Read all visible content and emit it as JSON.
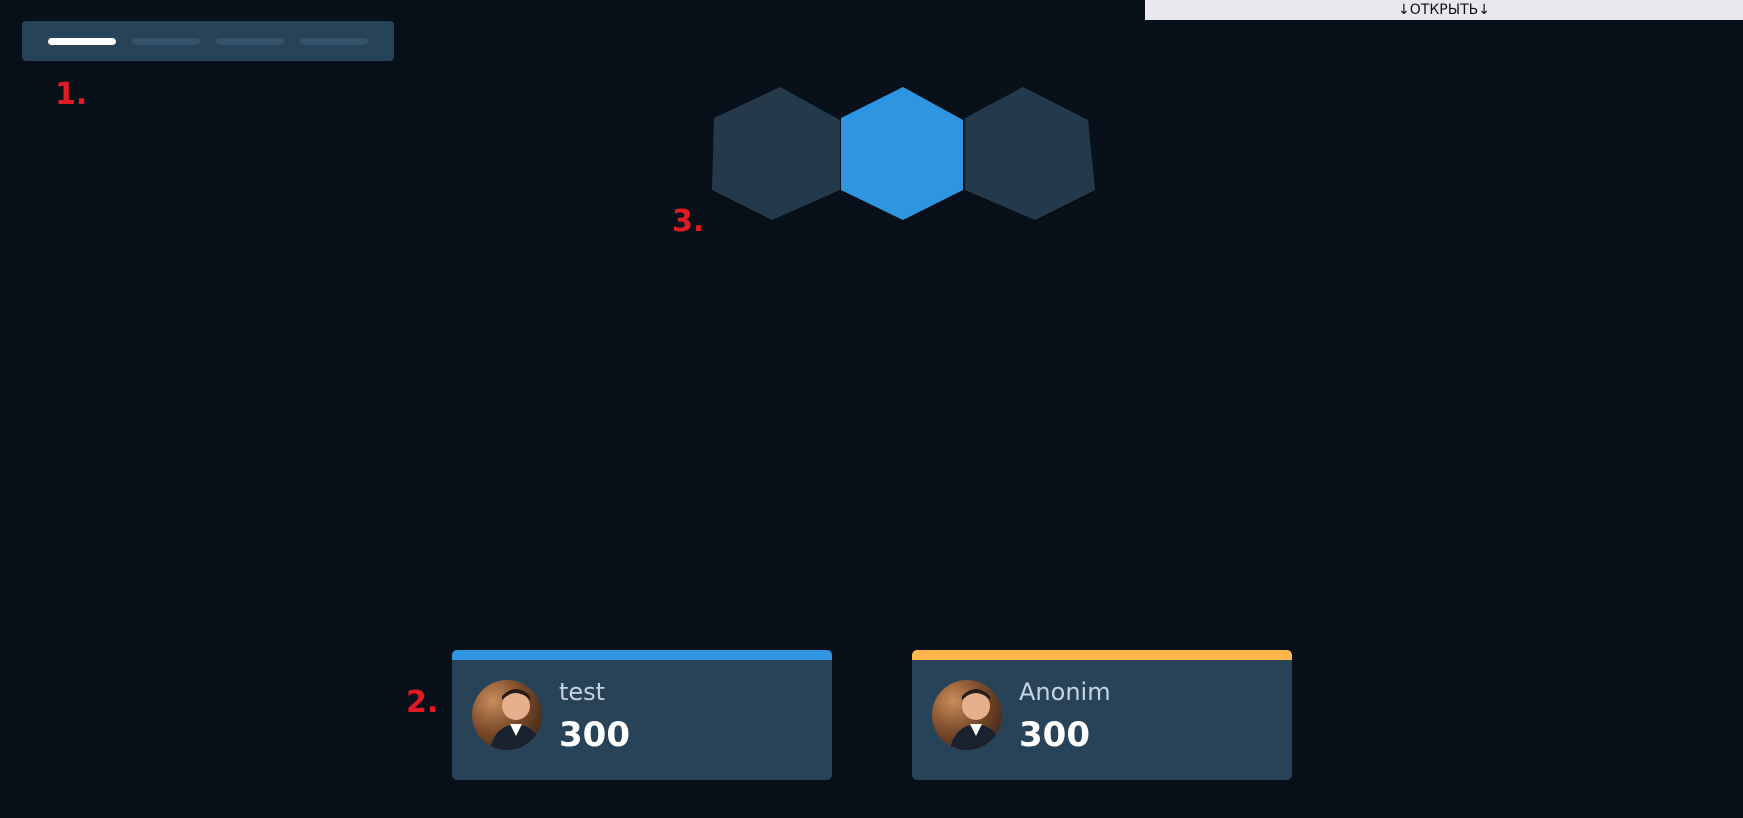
{
  "open_bar": {
    "label": "↓ОТКРЫТЬ↓"
  },
  "annotations": [
    "1.",
    "2.",
    "3."
  ],
  "step_bar": {
    "total_steps": 4,
    "active_step": 1
  },
  "hexagons": {
    "count": 3,
    "active_index": 1
  },
  "players": [
    {
      "name": "test",
      "score": "300",
      "accent": "#2f95e0"
    },
    {
      "name": "Anonim",
      "score": "300",
      "accent": "#ffb74d"
    }
  ],
  "colors": {
    "background": "#08111a",
    "panel": "#284357",
    "hex_inactive": "#243a4b",
    "hex_active": "#2f95e0",
    "annotation": "#e01b24"
  }
}
